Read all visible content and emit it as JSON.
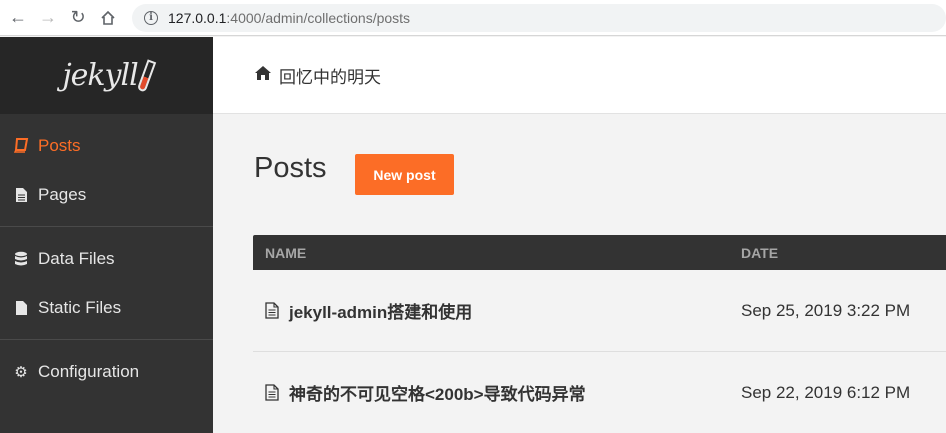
{
  "browser": {
    "url_host": "127.0.0.1",
    "url_path": ":4000/admin/collections/posts"
  },
  "sidebar": {
    "logo": "jekyll",
    "groups": [
      [
        {
          "label": "Posts",
          "icon": "book-icon",
          "active": true
        },
        {
          "label": "Pages",
          "icon": "file-text-icon"
        }
      ],
      [
        {
          "label": "Data Files",
          "icon": "database-icon"
        },
        {
          "label": "Static Files",
          "icon": "file-icon"
        }
      ],
      [
        {
          "label": "Configuration",
          "icon": "gear-icon"
        }
      ]
    ]
  },
  "header": {
    "site_title": "回忆中的明天"
  },
  "main": {
    "title": "Posts",
    "new_post_label": "New post",
    "table": {
      "columns": [
        "NAME",
        "DATE"
      ],
      "rows": [
        {
          "name": "jekyll-admin搭建和使用",
          "date": "Sep 25, 2019 3:22 PM"
        },
        {
          "name": "神奇的不可见空格<200b>导致代码异常",
          "date": "Sep 22, 2019 6:12 PM"
        }
      ]
    }
  },
  "colors": {
    "accent": "#fc6d26",
    "sidebar_bg": "#333333",
    "logo_bg": "#262626"
  }
}
